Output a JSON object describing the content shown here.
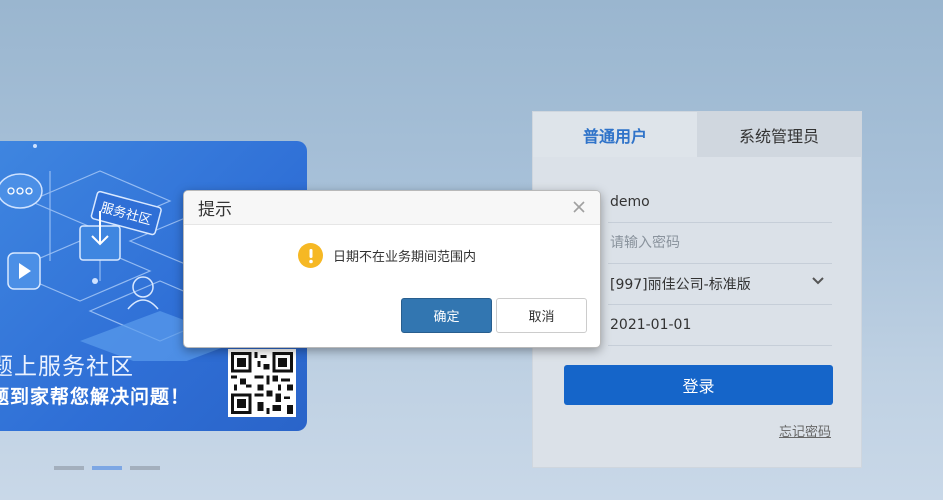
{
  "banner": {
    "badge_text": "服务社区",
    "title": "题上服务社区",
    "slogan": "题到家帮您解决问题！"
  },
  "carousel": {
    "dots": 3,
    "active_index": 1
  },
  "login": {
    "tabs": [
      {
        "label": "普通用户",
        "active": true
      },
      {
        "label": "系统管理员",
        "active": false
      }
    ],
    "username_value": "demo",
    "password_placeholder": "请输入密码",
    "company_selected": "[997]丽佳公司-标准版",
    "date_value": "2021-01-01",
    "login_button": "登录",
    "forgot_link": "忘记密码"
  },
  "dialog": {
    "title": "提示",
    "message": "日期不在业务期间范围内",
    "ok_label": "确定",
    "cancel_label": "取消",
    "icon": "warning-icon"
  },
  "colors": {
    "accent": "#1565c9",
    "tab_active_text": "#2f73c9",
    "dialog_ok": "#3276b1",
    "warning": "#f6b824"
  }
}
